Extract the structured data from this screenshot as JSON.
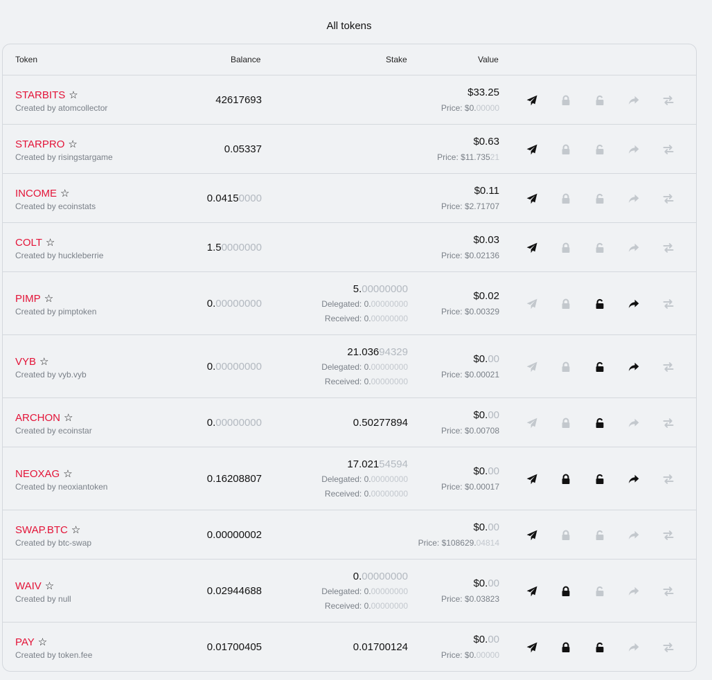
{
  "page": {
    "title": "All tokens"
  },
  "columns": {
    "token": "Token",
    "balance": "Balance",
    "stake": "Stake",
    "value": "Value"
  },
  "colors": {
    "token_name": "#e31337",
    "active_icon": "#111111",
    "inactive_icon": "#c3c8cd"
  },
  "tokens": [
    {
      "symbol": "STARBITS",
      "creator": "Created by atomcollector",
      "balance": [
        "42617693",
        ""
      ],
      "stake": null,
      "value": [
        "$33.25",
        ""
      ],
      "price_prefix": "Price: $0.",
      "price": [
        "",
        "00000"
      ],
      "actions": {
        "send": true,
        "stake": false,
        "unstake": false,
        "delegate": false,
        "swap": false
      }
    },
    {
      "symbol": "STARPRO",
      "creator": "Created by risingstargame",
      "balance": [
        "0.05337",
        ""
      ],
      "stake": null,
      "value": [
        "$0.63",
        ""
      ],
      "price_prefix": "Price: $11.735",
      "price": [
        "",
        "21"
      ],
      "actions": {
        "send": true,
        "stake": false,
        "unstake": false,
        "delegate": false,
        "swap": false
      }
    },
    {
      "symbol": "INCOME",
      "creator": "Created by ecoinstats",
      "balance": [
        "0.0415",
        "0000"
      ],
      "stake": null,
      "value": [
        "$0.11",
        ""
      ],
      "price_prefix": "Price: $2.71707",
      "price": [
        "",
        ""
      ],
      "actions": {
        "send": true,
        "stake": false,
        "unstake": false,
        "delegate": false,
        "swap": false
      }
    },
    {
      "symbol": "COLT",
      "creator": "Created by huckleberrie",
      "balance": [
        "1.5",
        "0000000"
      ],
      "stake": null,
      "value": [
        "$0.03",
        ""
      ],
      "price_prefix": "Price: $0.02136",
      "price": [
        "",
        ""
      ],
      "actions": {
        "send": true,
        "stake": false,
        "unstake": false,
        "delegate": false,
        "swap": false
      }
    },
    {
      "symbol": "PIMP",
      "creator": "Created by pimptoken",
      "balance": [
        "0.",
        "00000000"
      ],
      "stake": {
        "amount": [
          "5.",
          "00000000"
        ],
        "delegated": [
          "Delegated: 0.",
          "00000000"
        ],
        "received": [
          "Received: 0.",
          "00000000"
        ]
      },
      "value": [
        "$0.02",
        ""
      ],
      "price_prefix": "Price: $0.00329",
      "price": [
        "",
        ""
      ],
      "actions": {
        "send": false,
        "stake": false,
        "unstake": true,
        "delegate": true,
        "swap": false
      }
    },
    {
      "symbol": "VYB",
      "creator": "Created by vyb.vyb",
      "balance": [
        "0.",
        "00000000"
      ],
      "stake": {
        "amount": [
          "21.036",
          "94329"
        ],
        "delegated": [
          "Delegated: 0.",
          "00000000"
        ],
        "received": [
          "Received: 0.",
          "00000000"
        ]
      },
      "value": [
        "$0.",
        "00"
      ],
      "price_prefix": "Price: $0.00021",
      "price": [
        "",
        ""
      ],
      "actions": {
        "send": false,
        "stake": false,
        "unstake": true,
        "delegate": true,
        "swap": false
      }
    },
    {
      "symbol": "ARCHON",
      "creator": "Created by ecoinstar",
      "balance": [
        "0.",
        "00000000"
      ],
      "stake": {
        "amount": [
          "0.50277894",
          ""
        ]
      },
      "value": [
        "$0.",
        "00"
      ],
      "price_prefix": "Price: $0.00708",
      "price": [
        "",
        ""
      ],
      "actions": {
        "send": false,
        "stake": false,
        "unstake": true,
        "delegate": false,
        "swap": false
      }
    },
    {
      "symbol": "NEOXAG",
      "creator": "Created by neoxiantoken",
      "balance": [
        "0.16208807",
        ""
      ],
      "stake": {
        "amount": [
          "17.021",
          "54594"
        ],
        "delegated": [
          "Delegated: 0.",
          "00000000"
        ],
        "received": [
          "Received: 0.",
          "00000000"
        ]
      },
      "value": [
        "$0.",
        "00"
      ],
      "price_prefix": "Price: $0.00017",
      "price": [
        "",
        ""
      ],
      "actions": {
        "send": true,
        "stake": true,
        "unstake": true,
        "delegate": true,
        "swap": false
      }
    },
    {
      "symbol": "SWAP.BTC",
      "creator": "Created by btc-swap",
      "balance": [
        "0.00000002",
        ""
      ],
      "stake": null,
      "value": [
        "$0.",
        "00"
      ],
      "price_prefix": "Price: $108629.",
      "price": [
        "",
        "04814"
      ],
      "actions": {
        "send": true,
        "stake": false,
        "unstake": false,
        "delegate": false,
        "swap": false
      }
    },
    {
      "symbol": "WAIV",
      "creator": "Created by null",
      "balance": [
        "0.02944688",
        ""
      ],
      "stake": {
        "amount": [
          "0.",
          "00000000"
        ],
        "delegated": [
          "Delegated: 0.",
          "00000000"
        ],
        "received": [
          "Received: 0.",
          "00000000"
        ]
      },
      "value": [
        "$0.",
        "00"
      ],
      "price_prefix": "Price: $0.03823",
      "price": [
        "",
        ""
      ],
      "actions": {
        "send": true,
        "stake": true,
        "unstake": false,
        "delegate": false,
        "swap": false
      }
    },
    {
      "symbol": "PAY",
      "creator": "Created by token.fee",
      "balance": [
        "0.01700405",
        ""
      ],
      "stake": {
        "amount": [
          "0.01700124",
          ""
        ]
      },
      "value": [
        "$0.",
        "00"
      ],
      "price_prefix": "Price: $0.",
      "price": [
        "",
        "00000"
      ],
      "actions": {
        "send": true,
        "stake": true,
        "unstake": true,
        "delegate": false,
        "swap": false
      }
    }
  ]
}
